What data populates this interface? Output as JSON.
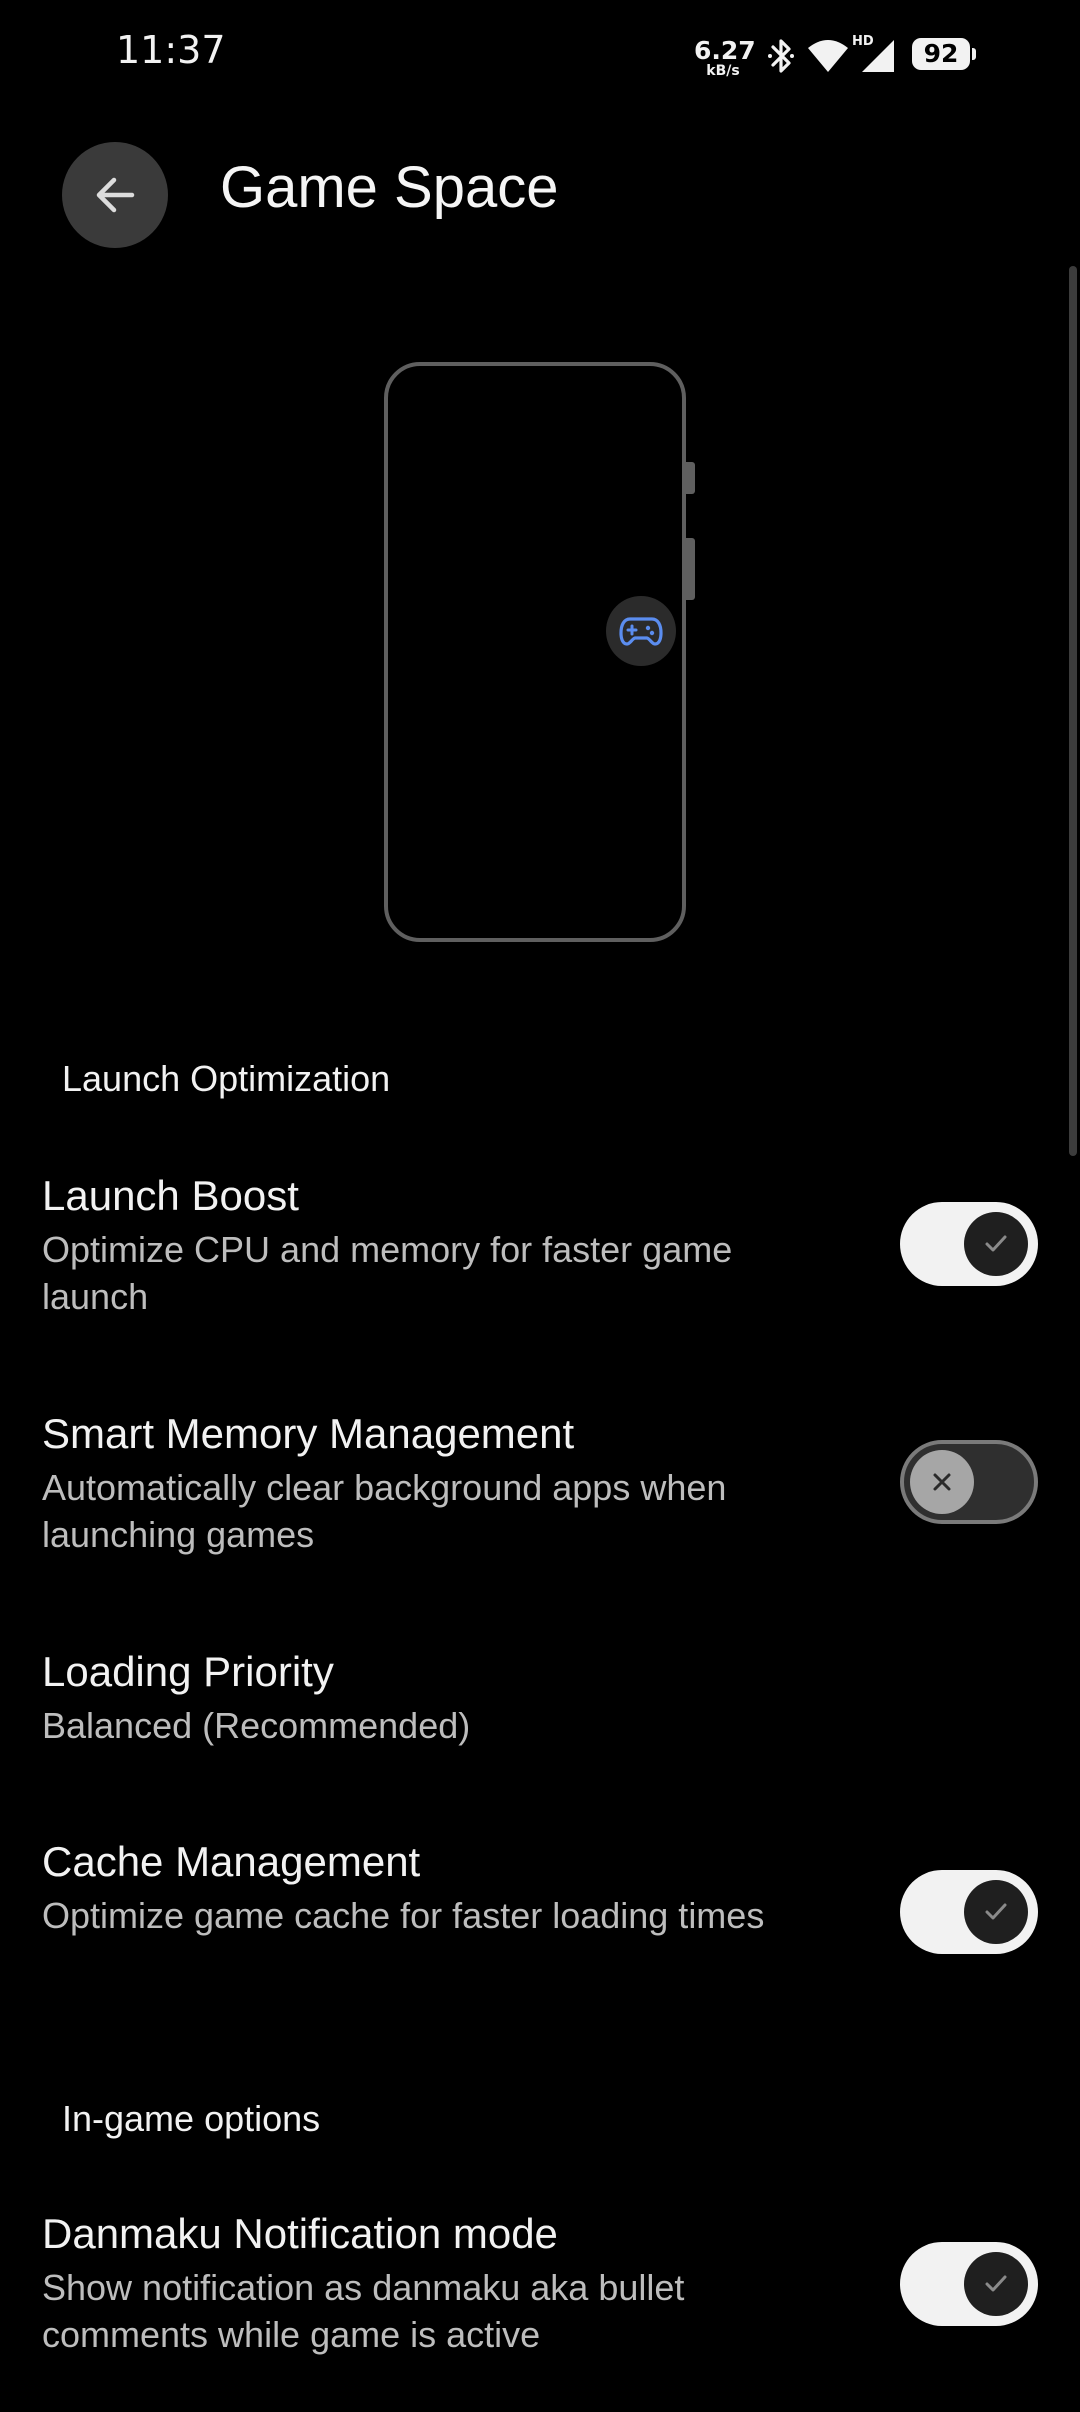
{
  "status_bar": {
    "time": "11:37",
    "net_speed_value": "6.27",
    "net_speed_unit": "kB/s",
    "icons": [
      "bluetooth-icon",
      "wifi-icon",
      "hd-icon",
      "cellular-signal-icon"
    ],
    "network_label": "HD",
    "battery_level": "92"
  },
  "header": {
    "title": "Game Space",
    "back_icon": "arrow-left-icon"
  },
  "illustration": {
    "icon": "gamepad-icon",
    "accent_color": "#5b8def"
  },
  "sections": {
    "launch_optimization": {
      "title": "Launch Optimization",
      "settings": [
        {
          "title": "Launch Boost",
          "description": "Optimize CPU and memory for faster game launch",
          "toggle": "on"
        },
        {
          "title": "Smart Memory Management",
          "description": "Automatically clear background apps when launching games",
          "toggle": "off"
        },
        {
          "title": "Loading Priority",
          "description": "Balanced (Recommended)"
        },
        {
          "title": "Cache Management",
          "description": "Optimize game cache for faster loading times",
          "toggle": "on"
        }
      ]
    },
    "in_game_options": {
      "title": "In-game options",
      "settings": [
        {
          "title": "Danmaku Notification mode",
          "description": "Show notification as danmaku aka bullet comments while game is active",
          "toggle": "on"
        }
      ]
    }
  },
  "colors": {
    "background": "#000000",
    "switch_on_track": "#f2f2f2",
    "switch_off_track": "#2f2f2f"
  }
}
